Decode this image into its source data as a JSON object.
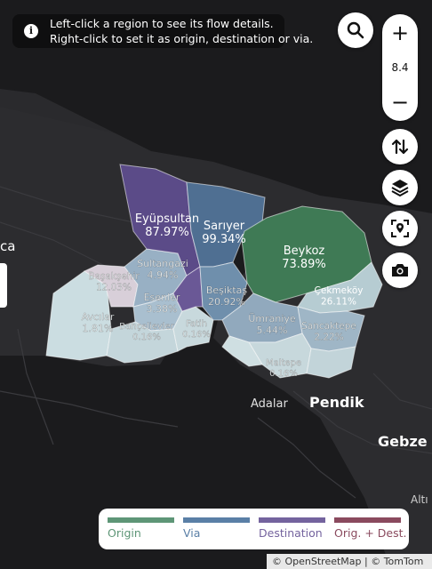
{
  "info": {
    "line1": "Left-click a region to see its flow details.",
    "line2": "Right-click to set it as origin, destination or via."
  },
  "controls": {
    "zoom_in": "+",
    "zoom_level": "8.4",
    "zoom_out": "−",
    "search_icon": "search-icon",
    "swap_icon": "swap-vertical-icon",
    "layers_icon": "layers-icon",
    "locate_icon": "locate-icon",
    "camera_icon": "camera-icon"
  },
  "districts": [
    {
      "name": "Eyüpsultan",
      "pct": "87.97%",
      "role": "destination"
    },
    {
      "name": "Sarıyer",
      "pct": "99.34%",
      "role": "via"
    },
    {
      "name": "Beykoz",
      "pct": "73.89%",
      "role": "origin"
    },
    {
      "name": "Başakşehir",
      "pct": "12.03%",
      "role": "orig-dest"
    },
    {
      "name": "Sultangazi",
      "pct": "4.94%",
      "role": "via"
    },
    {
      "name": "Esenler",
      "pct": "3.38%",
      "role": "via"
    },
    {
      "name": "Beşiktaş",
      "pct": "20.92%",
      "role": "via"
    },
    {
      "name": "Avcılar",
      "pct": "1.81%",
      "role": "none"
    },
    {
      "name": "Bahçelievler",
      "pct": "0.16%",
      "role": "none"
    },
    {
      "name": "Fatih",
      "pct": "0.16%",
      "role": "none"
    },
    {
      "name": "Ümraniye",
      "pct": "5.44%",
      "role": "via"
    },
    {
      "name": "Çekmeköy",
      "pct": "26.11%",
      "role": "origin"
    },
    {
      "name": "Sancaktepe",
      "pct": "2.22%",
      "role": "via"
    },
    {
      "name": "Maltepe",
      "pct": "0.16%",
      "role": "none"
    }
  ],
  "place_labels": {
    "adalar": "Adalar",
    "pendik": "Pendik",
    "gebze": "Gebze",
    "altinova": "Altı",
    "edge_ca": "ca"
  },
  "legend": {
    "items": [
      {
        "label": "Origin",
        "color": "#5e9677"
      },
      {
        "label": "Via",
        "color": "#5a7fa6"
      },
      {
        "label": "Destination",
        "color": "#74639e"
      },
      {
        "label": "Orig. + Dest.",
        "color": "#8a4a5e"
      }
    ]
  },
  "attribution": "© OpenStreetMap | © TomTom",
  "colors": {
    "origin": "#3f7a55",
    "via": "#4f6f92",
    "destination": "#5a4a86",
    "neutral": "#c7d8dc",
    "land": "#2b2b2e",
    "water": "#1b1b1d"
  }
}
